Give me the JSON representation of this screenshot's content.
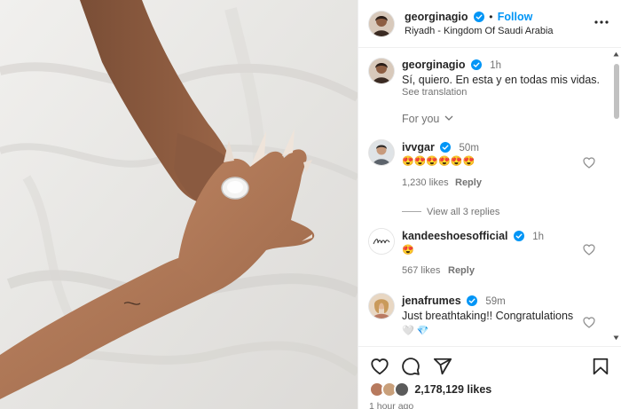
{
  "post": {
    "author": "georginagio",
    "follow_label": "Follow",
    "location": "Riyadh - Kingdom Of Saudi Arabia",
    "caption": {
      "author": "georginagio",
      "time": "1h",
      "text": "Sí, quiero. En esta y en todas mis vidas.",
      "see_translation": "See translation"
    },
    "for_you_label": "For you"
  },
  "comments": [
    {
      "author": "ivvgar",
      "time": "50m",
      "text": "😍😍😍😍😍😍",
      "likes": "1,230 likes",
      "reply": "Reply",
      "view_replies": "View all 3 replies"
    },
    {
      "author": "kandeeshoesofficial",
      "time": "1h",
      "text": "😍",
      "likes": "567 likes",
      "reply": "Reply",
      "avatar_text": "Kandee"
    },
    {
      "author": "jenafrumes",
      "time": "59m",
      "text": "Just breathtaking!! Congratulations",
      "emojis": "🤍 💎"
    }
  ],
  "footer": {
    "likes": "2,178,129 likes",
    "posted": "1 hour ago"
  },
  "colors": {
    "accent": "#0095f6",
    "verified": "#0095f6",
    "muted": "#737373"
  },
  "icons": [
    "heart-icon",
    "comment-icon",
    "share-icon",
    "bookmark-icon",
    "more-options-icon",
    "verified-icon",
    "chevron-down-icon"
  ]
}
